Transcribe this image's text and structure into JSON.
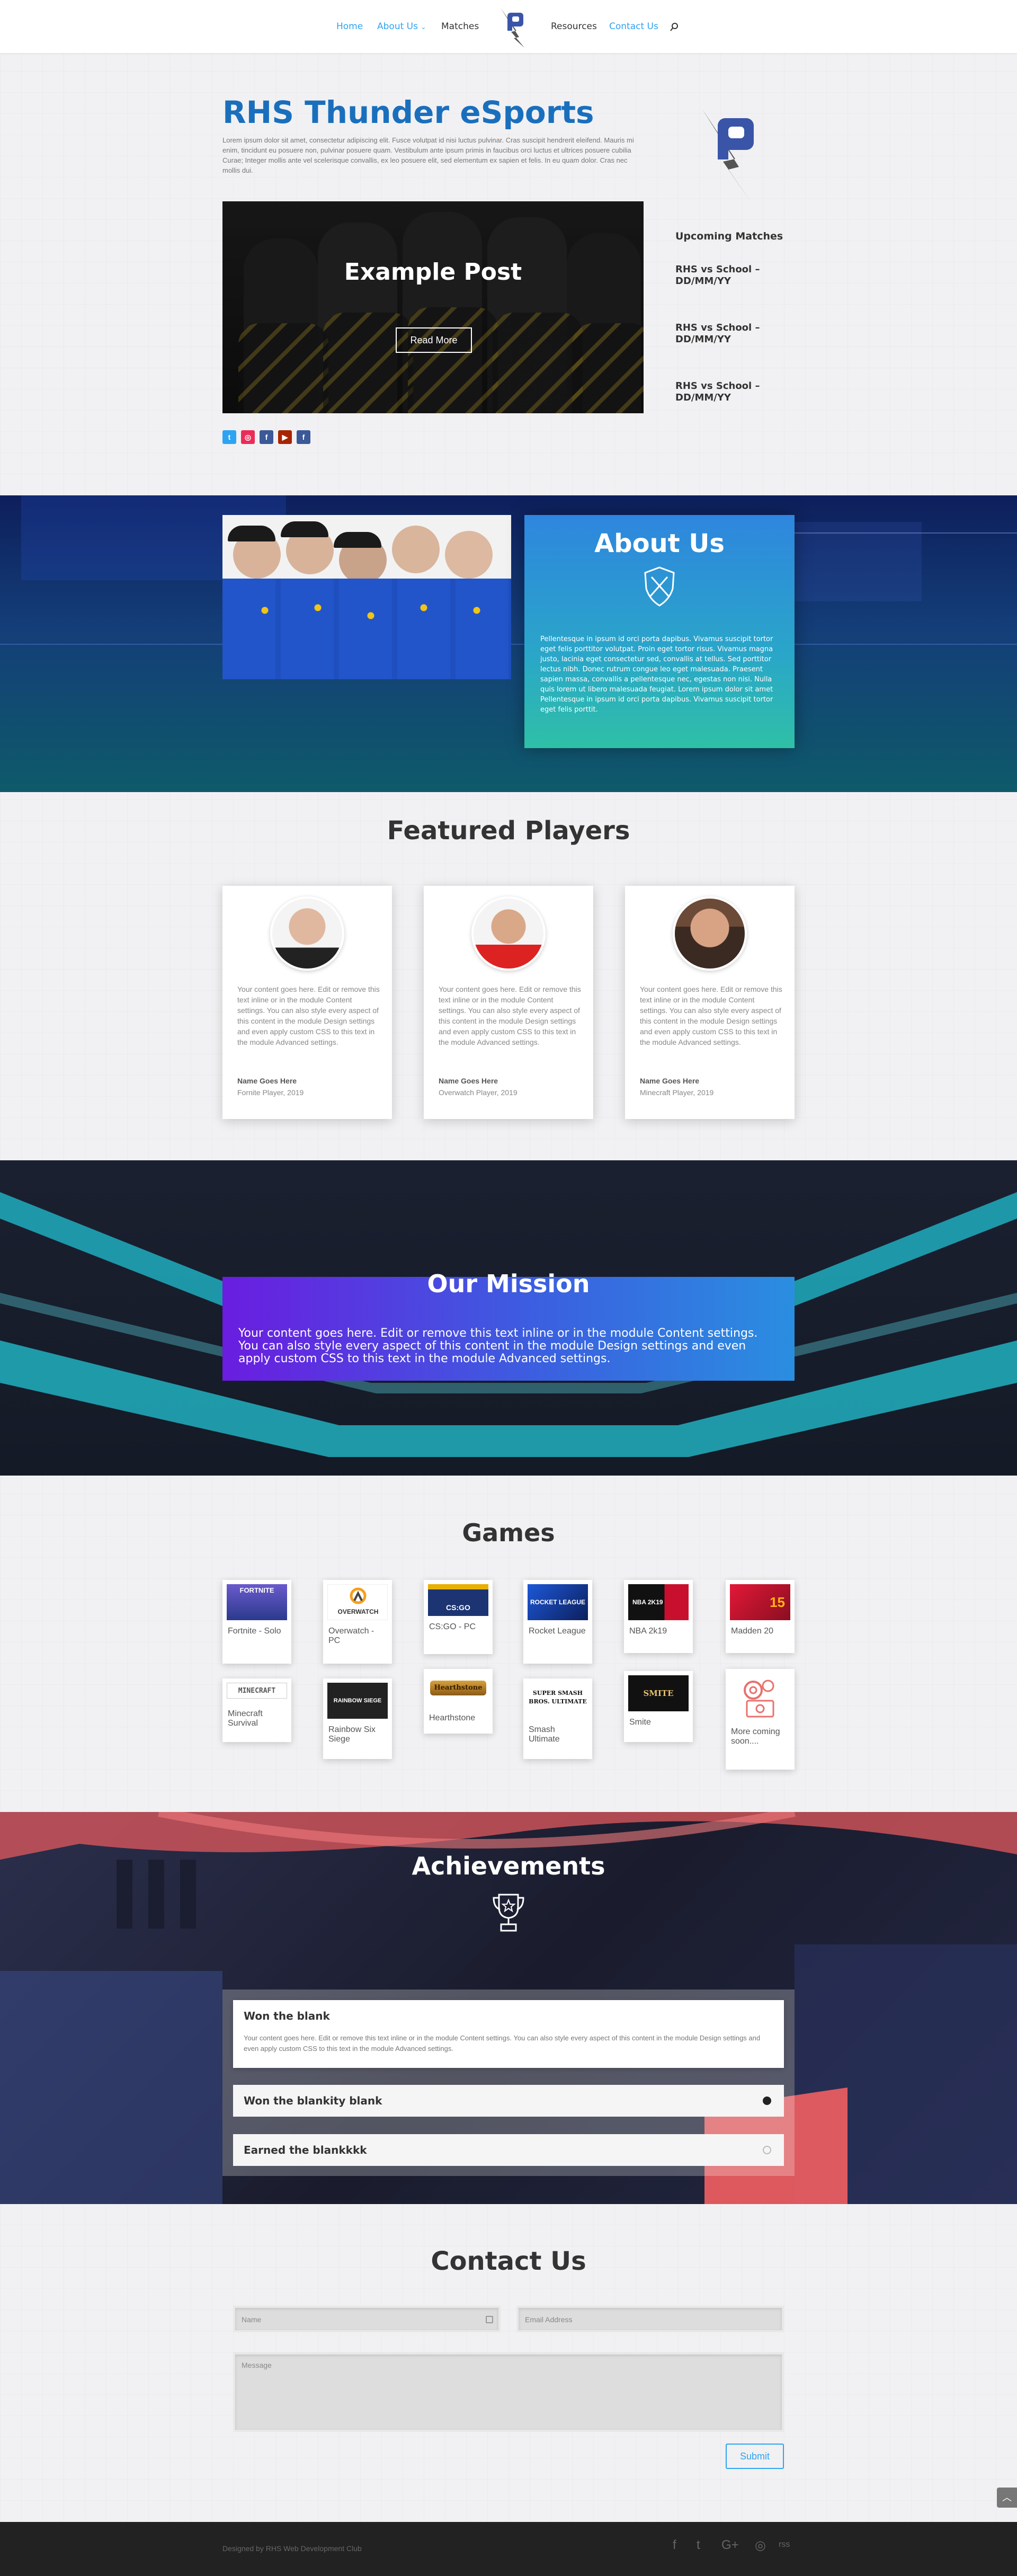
{
  "nav": {
    "left": [
      "Home",
      "About Us",
      "Matches"
    ],
    "right": [
      "Resources",
      "Contact Us"
    ],
    "about_caret": "⌄"
  },
  "hero": {
    "title": "RHS Thunder eSports",
    "intro": "Lorem ipsum dolor sit amet, consectetur adipiscing elit. Fusce volutpat id nisi luctus pulvinar. Cras suscipit hendrerit eleifend. Mauris mi enim, tincidunt eu posuere non, pulvinar posuere quam. Vestibulum ante ipsum primis in faucibus orci luctus et ultrices posuere cubilia Curae; Integer mollis ante vel scelerisque convallis, ex leo posuere elit, sed elementum ex sapien et felis. In eu quam dolor. Cras nec mollis dui.",
    "post_title": "Example Post",
    "read_more": "Read More",
    "upcoming_title": "Upcoming Matches",
    "matches": [
      "RHS vs School – DD/MM/YY",
      "RHS vs School – DD/MM/YY",
      "RHS vs School – DD/MM/YY"
    ],
    "social": [
      "t",
      "◎",
      "f",
      "▶",
      "f"
    ]
  },
  "about": {
    "title": "About Us",
    "text": "Pellentesque in ipsum id orci porta dapibus. Vivamus suscipit tortor eget felis porttitor volutpat. Proin eget tortor risus. Vivamus magna justo, lacinia eget consectetur sed, convallis at tellus. Sed porttitor lectus nibh. Donec rutrum congue leo eget malesuada. Praesent sapien massa, convallis a pellentesque nec, egestas non nisi. Nulla quis lorem ut libero malesuada feugiat. Lorem ipsum dolor sit amet Pellentesque in ipsum id orci porta dapibus. Vivamus suscipit tortor eget felis porttit."
  },
  "players": {
    "title": "Featured Players",
    "items": [
      {
        "text": "Your content goes here. Edit or remove this text inline or in the module Content settings. You can also style every aspect of this content in the module Design settings and even apply custom CSS to this text in the module Advanced settings.",
        "name": "Name Goes Here",
        "role": "Fornite Player, 2019"
      },
      {
        "text": "Your content goes here. Edit or remove this text inline or in the module Content settings. You can also style every aspect of this content in the module Design settings and even apply custom CSS to this text in the module Advanced settings.",
        "name": "Name Goes Here",
        "role": "Overwatch Player, 2019"
      },
      {
        "text": "Your content goes here. Edit or remove this text inline or in the module Content settings. You can also style every aspect of this content in the module Design settings and even apply custom CSS to this text in the module Advanced settings.",
        "name": "Name Goes Here",
        "role": "Minecraft Player, 2019"
      }
    ]
  },
  "mission": {
    "title": "Our Mission",
    "text": "Your content goes here. Edit or remove this text inline or in the module Content settings. You can also style every aspect of this content in the module Design settings and even apply custom CSS to this text in the module Advanced settings."
  },
  "games": {
    "title": "Games",
    "row1": [
      "Fortnite - Solo",
      "Overwatch - PC",
      "CS:GO - PC",
      "Rocket League",
      "NBA 2k19",
      "Madden 20"
    ],
    "row2": [
      "Minecraft Survival",
      "Rainbow Six Siege",
      "Hearthstone",
      "Smash Ultimate",
      "Smite",
      "More coming soon...."
    ],
    "thumb_text": {
      "fortnite": "FORTNITE",
      "overwatch": "OVERWATCH",
      "csgo": "CS:GO",
      "rocket": "ROCKET LEAGUE",
      "nba": "NBA 2K19",
      "madden": "15",
      "minecraft": "MINECRAFT",
      "r6": "RAINBOW SIEGE",
      "hearth": "Hearthstone",
      "smash": "SUPER SMASH BROS. ULTIMATE",
      "smite": "SMITE"
    }
  },
  "achievements": {
    "title": "Achievements",
    "open_title": "Won the blank",
    "open_text": "Your content goes here. Edit or remove this text inline or in the module Content settings. You can also style every aspect of this content in the module Design settings and even apply custom CSS to this text in the module Advanced settings.",
    "items": [
      "Won the blankity blank",
      "Earned the blankkkk"
    ]
  },
  "contact": {
    "title": "Contact Us",
    "name_placeholder": "Name",
    "email_placeholder": "Email Address",
    "message_placeholder": "Message",
    "submit": "Submit"
  },
  "footer": {
    "credit": "Designed by RHS Web Development Club",
    "icons": [
      "f",
      "t",
      "G+",
      "◎",
      "rss"
    ]
  },
  "colors": {
    "accent": "#2ea3f2",
    "title_blue": "#1a6fbd"
  }
}
